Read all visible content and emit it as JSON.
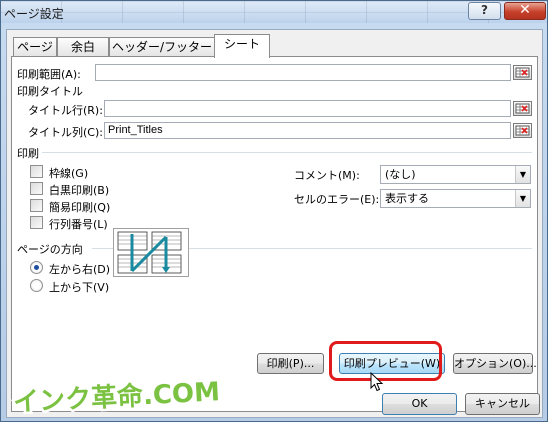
{
  "window": {
    "title": "ページ設定",
    "help_label": "?",
    "close_label": "✕"
  },
  "tabs": [
    {
      "label": "ページ"
    },
    {
      "label": "余白"
    },
    {
      "label": "ヘッダー/フッター"
    },
    {
      "label": "シート"
    }
  ],
  "print_area": {
    "label": "印刷範囲(A):",
    "value": ""
  },
  "print_titles": {
    "heading": "印刷タイトル",
    "rows_label": "タイトル行(R):",
    "rows_value": "",
    "cols_label": "タイトル列(C):",
    "cols_value": "Print_Titles"
  },
  "print": {
    "heading": "印刷",
    "checkboxes": [
      {
        "label": "枠線(G)"
      },
      {
        "label": "白黒印刷(B)"
      },
      {
        "label": "簡易印刷(Q)"
      },
      {
        "label": "行列番号(L)"
      }
    ],
    "comments_label": "コメント(M):",
    "comments_value": "(なし)",
    "errors_label": "セルのエラー(E):",
    "errors_value": "表示する"
  },
  "order": {
    "heading": "ページの方向",
    "option1": "左から右(D)",
    "option2": "上から下(V)"
  },
  "buttons": {
    "print": "印刷(P)...",
    "preview": "印刷プレビュー(W)",
    "options": "オプション(O)...",
    "ok": "OK",
    "cancel": "キャンセル"
  },
  "watermark": {
    "text": "インク革命.COM"
  },
  "colors": {
    "highlight": "#e11b1b",
    "accent": "#1f4fa3",
    "logo_green": "#7cc242"
  },
  "icons": [
    "range-picker-icon",
    "close-icon",
    "help-icon",
    "mouse-cursor-icon",
    "page-order-icon"
  ]
}
